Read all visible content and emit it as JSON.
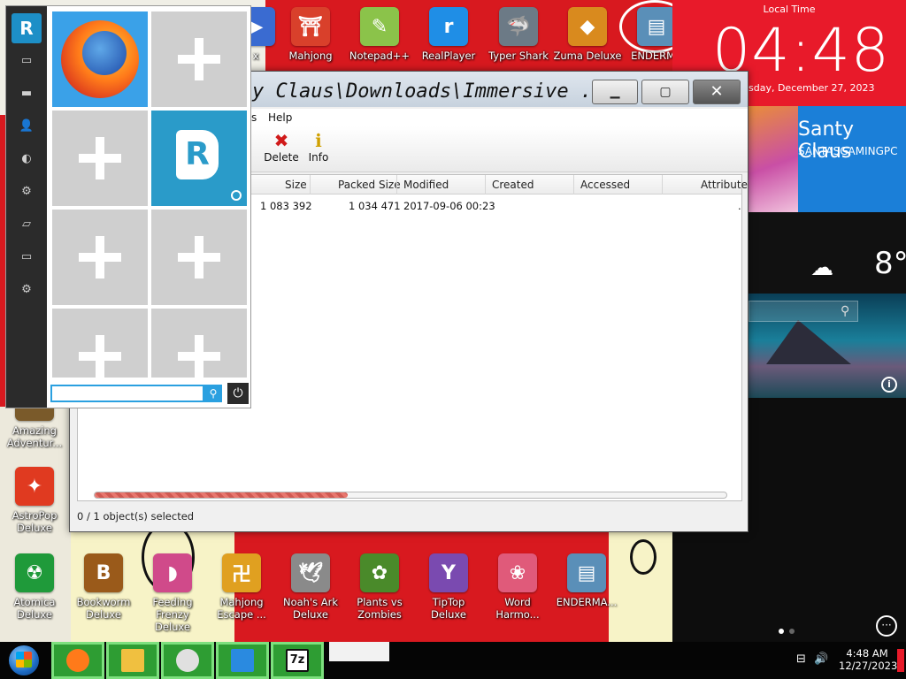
{
  "desktop": {
    "top_icons": [
      {
        "label": "x",
        "glyph": "▶",
        "color": "#3a6bd1"
      },
      {
        "label": "Mahjong",
        "glyph": "⛩",
        "color": "#d9402b"
      },
      {
        "label": "Notepad++",
        "glyph": "✎",
        "color": "#8bc34a"
      },
      {
        "label": "RealPlayer",
        "glyph": "r",
        "color": "#1f8ee6"
      },
      {
        "label": "Typer Shark",
        "glyph": "🦈",
        "color": "#6c7a86"
      },
      {
        "label": "Zuma Deluxe",
        "glyph": "◆",
        "color": "#d98a1e"
      },
      {
        "label": "ENDERMA",
        "glyph": "▤",
        "color": "#5a8fb8"
      }
    ],
    "left_icons": [
      {
        "label": "Amazing Adventur...",
        "glyph": "★",
        "color": "#7a5a2a"
      },
      {
        "label": "AstroPop Deluxe",
        "glyph": "✦",
        "color": "#e03a20"
      }
    ],
    "bottom_icons": [
      {
        "label": "Atomica Deluxe",
        "glyph": "☢",
        "color": "#1f9a3a"
      },
      {
        "label": "Bookworm Deluxe",
        "glyph": "B",
        "color": "#9a5a1a"
      },
      {
        "label": "Feeding Frenzy Deluxe",
        "glyph": "◗",
        "color": "#d04a8a"
      },
      {
        "label": "Mahjong Escape ...",
        "glyph": "卍",
        "color": "#e0a020"
      },
      {
        "label": "Noah's Ark Deluxe",
        "glyph": "🕊",
        "color": "#8a8a8a"
      },
      {
        "label": "Plants vs Zombies",
        "glyph": "✿",
        "color": "#4a8a2a"
      },
      {
        "label": "TipTop Deluxe",
        "glyph": "Y",
        "color": "#7a4ab0"
      },
      {
        "label": "Word Harmo...",
        "glyph": "❀",
        "color": "#e05a7a"
      },
      {
        "label": "ENDERMA...",
        "glyph": "▤",
        "color": "#5a8fb8"
      }
    ],
    "shortcut_glyph": "↗"
  },
  "right_panel": {
    "clock_caption": "Local Time",
    "time": "04:48",
    "date": "sday, December 27, 2023",
    "user_name": "Santy Claus",
    "computer_name": "SANTASGAMINGPC",
    "weather_icon": "cloud-icon",
    "weather_glyph": "☁",
    "temperature": "8°",
    "search_glyph": "⚲",
    "info_glyph": "i",
    "more_glyph": "···",
    "page_dots": 2,
    "active_dot": 0
  },
  "window": {
    "title": "y Claus\\Downloads\\Immersive ...",
    "minimize": "▁",
    "maximize": "▢",
    "close": "✕",
    "menu": {
      "m1": "s",
      "m2": "Help"
    },
    "toolbar": {
      "partial_label": "e",
      "delete_label": "Delete",
      "delete_glyph": "✖",
      "info_label": "Info",
      "info_glyph": "ℹ"
    },
    "columns": {
      "size": "Size",
      "packed": "Packed Size",
      "modified": "Modified",
      "created": "Created",
      "accessed": "Accessed",
      "attributes": "Attribute"
    },
    "rows": [
      {
        "size": "1 083 392",
        "packed": "1 034 471",
        "modified": "2017-09-06 00:23",
        "created": "",
        "accessed": "",
        "attributes": "."
      }
    ],
    "scroll_fraction": 0.4,
    "status": "0 / 1 object(s) selected"
  },
  "start_menu": {
    "rail_glyphs": [
      "▭",
      "▬",
      "👤",
      "◐",
      "⚙",
      "▱",
      "▭",
      "⚙"
    ],
    "search_placeholder": "",
    "search_glyph": "⚲",
    "power_glyph": "⏻"
  },
  "taskbar": {
    "apps": [
      {
        "name": "firefox",
        "color": "#ff7a1a"
      },
      {
        "name": "file-explorer",
        "color": "#f0c040"
      },
      {
        "name": "chrome",
        "color": "#e0e0e0"
      },
      {
        "name": "windows-store",
        "color": "#2a8ae0"
      },
      {
        "name": "7zip",
        "color": "#ffffff"
      }
    ],
    "seven_zip_label": "7z",
    "time": "4:48 AM",
    "date": "12/27/2023",
    "network_glyph": "⊟",
    "volume_glyph": "🔊"
  }
}
